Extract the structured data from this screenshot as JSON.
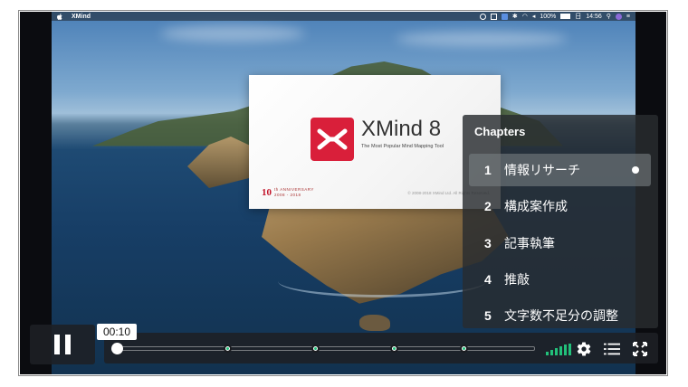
{
  "menubar": {
    "app_name": "XMind",
    "battery": "100%",
    "date": "日",
    "time": "14:56"
  },
  "splash": {
    "title": "XMind 8",
    "tagline": "The Most Popular Mind Mapping Tool",
    "anniversary_number": "10",
    "anniversary_label": "th ANNIVERSARY",
    "anniversary_years": "2008 - 2018",
    "copyright": "© 2008-2018 XMind Ltd. All Rights Reserved."
  },
  "chapters": {
    "heading": "Chapters",
    "items": [
      {
        "number": "1",
        "label": "情報リサーチ",
        "active": true
      },
      {
        "number": "2",
        "label": "構成案作成",
        "active": false
      },
      {
        "number": "3",
        "label": "記事執筆",
        "active": false
      },
      {
        "number": "4",
        "label": "推敲",
        "active": false
      },
      {
        "number": "5",
        "label": "文字数不足分の調整",
        "active": false
      }
    ]
  },
  "player": {
    "current_time": "00:10",
    "progress_fraction": 0.01,
    "accent_color": "#22c07a",
    "volume_level_fraction": 1.0,
    "chapter_markers": 4,
    "icons": [
      "pause-icon",
      "volume-bars-icon",
      "settings-gear-icon",
      "chapters-list-icon",
      "fullscreen-icon"
    ]
  }
}
